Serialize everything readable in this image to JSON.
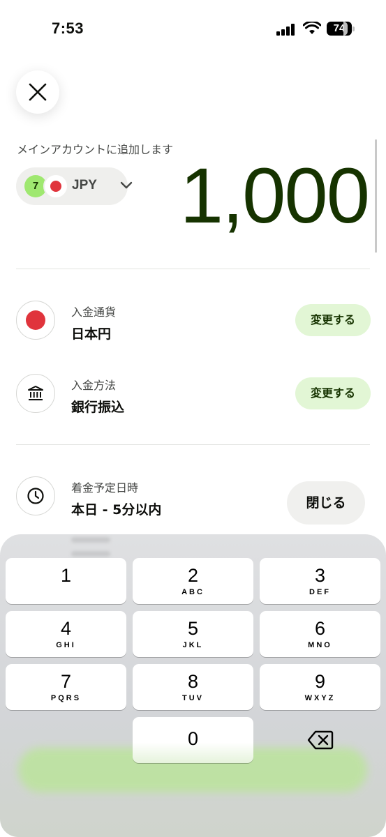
{
  "status_bar": {
    "time": "7:53",
    "battery": "74"
  },
  "header": {
    "close_icon": "close-icon",
    "add_to_label": "メインアカウントに追加します"
  },
  "currency_selector": {
    "logo_text": "7",
    "code": "JPY",
    "flag_color": "#e0343c"
  },
  "amount": {
    "value": "1,000"
  },
  "details": {
    "currency": {
      "label": "入金通貨",
      "value": "日本円",
      "action": "変更する"
    },
    "method": {
      "label": "入金方法",
      "value": "銀行振込",
      "action": "変更する"
    },
    "arrival": {
      "label": "着金予定日時",
      "value": "本日 - 5分以内",
      "action": "閉じる"
    }
  },
  "keypad": {
    "keys": [
      {
        "digit": "1",
        "letters": ""
      },
      {
        "digit": "2",
        "letters": "ABC"
      },
      {
        "digit": "3",
        "letters": "DEF"
      },
      {
        "digit": "4",
        "letters": "GHI"
      },
      {
        "digit": "5",
        "letters": "JKL"
      },
      {
        "digit": "6",
        "letters": "MNO"
      },
      {
        "digit": "7",
        "letters": "PQRS"
      },
      {
        "digit": "8",
        "letters": "TUV"
      },
      {
        "digit": "9",
        "letters": "WXYZ"
      },
      {
        "digit": "0",
        "letters": ""
      }
    ],
    "backspace_icon": "backspace-icon"
  },
  "colors": {
    "accent_green": "#9fe870",
    "dark_green": "#163300",
    "button_bg": "#e2f6d5"
  }
}
